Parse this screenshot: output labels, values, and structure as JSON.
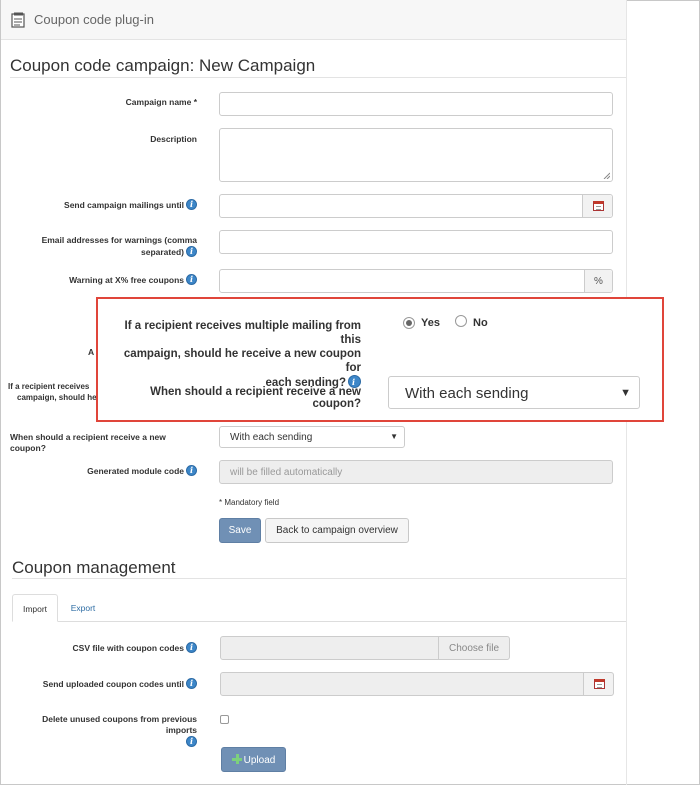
{
  "app": {
    "title": "Coupon code plug-in"
  },
  "campaign": {
    "heading": "Coupon code campaign: New Campaign",
    "fields": {
      "name_label": "Campaign name *",
      "description_label": "Description",
      "send_until_label": "Send campaign mailings until",
      "emails_label_line1": "Email addresses for warnings (comma",
      "emails_label_line2": "separated)",
      "warning_label": "Warning at X% free coupons",
      "warning_unit": "%",
      "bg_partial_a": "A",
      "bg_partial_line1": "If a recipient receives",
      "bg_partial_line2": "campaign, should he",
      "new_coupon_label": "When should a recipient receive a new coupon?",
      "new_coupon_value": "With each sending",
      "module_code_label": "Generated module code",
      "module_code_placeholder": "will be filled automatically"
    },
    "mandatory_note": "* Mandatory field",
    "save_label": "Save",
    "back_label": "Back to campaign overview"
  },
  "zoom": {
    "question_line1": "If a recipient receives multiple mailing from this",
    "question_line2": "campaign, should he receive a new coupon for",
    "question_line3": "each sending?",
    "yes_label": "Yes",
    "no_label": "No",
    "question2": "When should a recipient receive a new coupon?",
    "select_value": "With each sending"
  },
  "coupons": {
    "heading": "Coupon management",
    "tabs": [
      {
        "label": "Import"
      },
      {
        "label": "Export"
      }
    ],
    "csv_label": "CSV file with coupon codes",
    "choose_file_label": "Choose file",
    "send_uploaded_label": "Send uploaded coupon codes until",
    "delete_unused_label": "Delete unused coupons from previous imports",
    "upload_label": "Upload"
  },
  "colors": {
    "accent": "#7090b5",
    "highlight_border": "#e0453a",
    "info_icon": "#3c86c8"
  }
}
